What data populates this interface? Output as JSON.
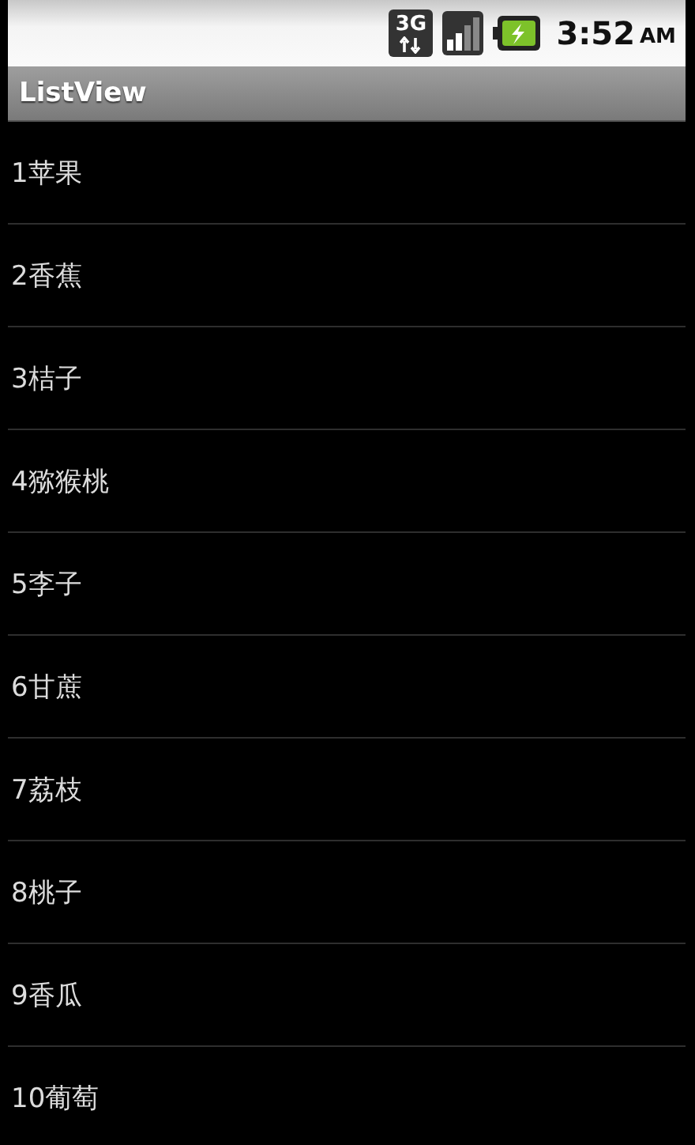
{
  "status_bar": {
    "network": "3G",
    "time": "3:52",
    "meridiem": "AM"
  },
  "title_bar": {
    "title": "ListView"
  },
  "list": {
    "items": [
      {
        "label": "1苹果"
      },
      {
        "label": "2香蕉"
      },
      {
        "label": "3桔子"
      },
      {
        "label": "4猕猴桃"
      },
      {
        "label": "5李子"
      },
      {
        "label": "6甘蔗"
      },
      {
        "label": "7荔枝"
      },
      {
        "label": "8桃子"
      },
      {
        "label": "9香瓜"
      },
      {
        "label": "10葡萄"
      }
    ]
  }
}
